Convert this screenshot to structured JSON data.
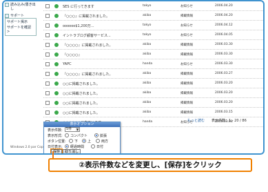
{
  "sidebar": {
    "items": [
      "読み込み/書き出し",
      "サポート"
    ],
    "box_items": [
      "サポート掲示",
      "サポートを確認 >"
    ]
  },
  "messages": [
    {
      "subject": "SES に行ってきます",
      "from": "tokyo",
      "category": "お知らせ",
      "date": "2006.04.20"
    },
    {
      "subject": "『○○○』に掲載されました。",
      "from": "akiba",
      "category": "掲載情報",
      "date": "2006.04.20"
    },
    {
      "subject": "oooooo$1,200万...",
      "from": "tokyo",
      "category": "お知らせ",
      "date": "2006.04.12"
    },
    {
      "subject": "イントラブログ顧客サービス...",
      "from": "tokyo",
      "category": "お知らせ",
      "date": "2006.04.05"
    },
    {
      "subject": "『○○○○』に掲載されました。",
      "from": "akiba",
      "category": "掲載情報",
      "date": "2006.03.30"
    },
    {
      "subject": "『○○○○』",
      "from": "akiba",
      "category": "掲載情報",
      "date": "2006.03.30"
    },
    {
      "subject": "YAPC",
      "from": "handa",
      "category": "お知らせ",
      "date": "2006.03.30"
    },
    {
      "subject": "『○○○○』に掲載されました。",
      "from": "akiba",
      "category": "掲載情報",
      "date": "2006.03.27"
    },
    {
      "subject": "○○に掲載されました。",
      "from": "akiba",
      "category": "掲載情報",
      "date": "2006.03.20"
    },
    {
      "subject": "○○に掲載されました。",
      "from": "akiba",
      "category": "掲載情報",
      "date": "2006.03.20"
    },
    {
      "subject": "○○に掲載されました。",
      "from": "akiba",
      "category": "掲載情報",
      "date": "2006.03.20"
    },
    {
      "subject": "○○に掲載されました。",
      "from": "akiba",
      "category": "掲載情報",
      "date": "2006.03.15"
    },
    {
      "subject": "○○○○○○に来ています。",
      "from": "handa",
      "category": "お知らせ",
      "date": "2006.03.08"
    }
  ],
  "pager": {
    "more": "もっと読む",
    "text": "表示件数：1 - 20 / 86"
  },
  "footer": "Windows  2.0  par Copyright",
  "dialog": {
    "title": "表示オプション",
    "count_label": "表示件数:",
    "count_value": "5件",
    "format_label": "表示形式:",
    "format_options": [
      "コンパクト",
      "拡張"
    ],
    "button_label": "ボタン位置:",
    "button_options": [
      "下",
      "上",
      "両方"
    ],
    "date_label": "日付表示:",
    "date_options": [
      "経過時間",
      "日付"
    ],
    "save": "保存",
    "cancel": "取り消し"
  },
  "instruction": "②表示件数などを変更し、[保存]をクリック",
  "colors": {
    "frame": "#3f93cf",
    "highlight": "#f08000",
    "dot": "#3aa84a"
  }
}
